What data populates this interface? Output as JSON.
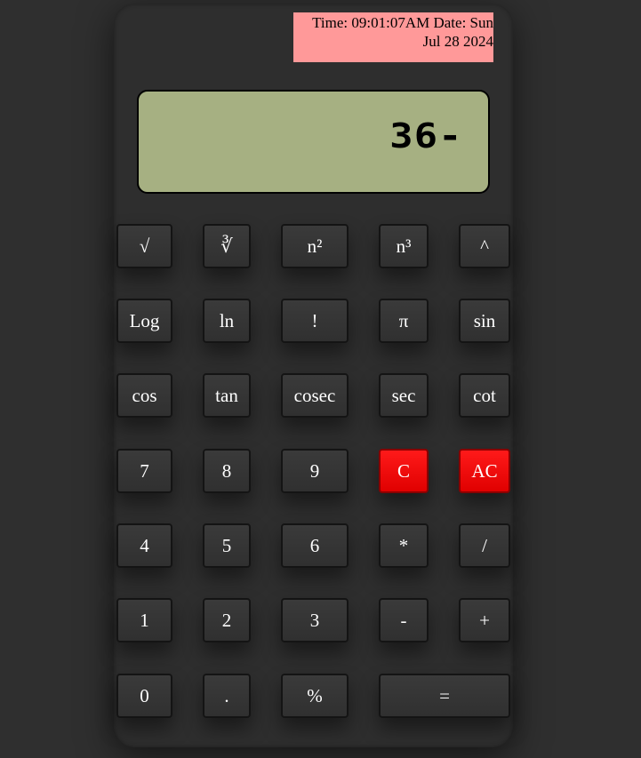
{
  "clock": {
    "text": "Time: 09:01:07AM Date: Sun Jul 28 2024"
  },
  "display": {
    "value": "36-"
  },
  "colors": {
    "body_background": "#2f2f2f",
    "calculator_body": "#2e2e2e",
    "clock_background": "#ff9999",
    "display_background": "#a6b082",
    "clear_buttons": "#ff0000"
  },
  "keys": {
    "sqrt": "√",
    "cbrt": "∛",
    "square": "n²",
    "cube": "n³",
    "power": "^",
    "log": "Log",
    "ln": "ln",
    "factorial": "!",
    "pi": "π",
    "sin": "sin",
    "cos": "cos",
    "tan": "tan",
    "cosec": "cosec",
    "sec": "sec",
    "cot": "cot",
    "seven": "7",
    "eight": "8",
    "nine": "9",
    "clear": "C",
    "all_clear": "AC",
    "four": "4",
    "five": "5",
    "six": "6",
    "multiply": "*",
    "divide": "/",
    "one": "1",
    "two": "2",
    "three": "3",
    "minus": "-",
    "plus": "+",
    "zero": "0",
    "decimal": ".",
    "percent": "%",
    "equals": "="
  }
}
